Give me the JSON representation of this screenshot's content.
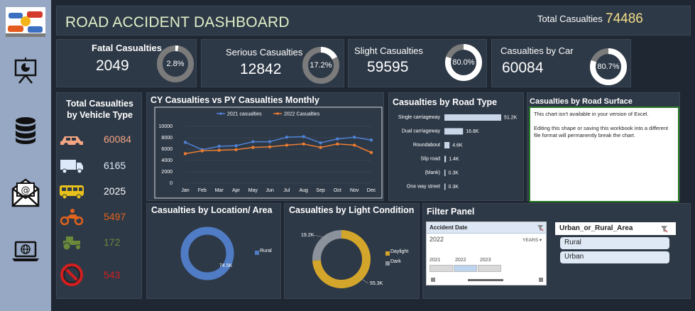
{
  "header": {
    "title": "ROAD ACCIDENT DASHBOARD",
    "total_label": "Total Casualties",
    "total_value": "74486"
  },
  "kpis": [
    {
      "label": "Fatal Casualties",
      "value": "2049",
      "pct": "2.8%",
      "fraction": 0.028
    },
    {
      "label": "Serious Casualties",
      "value": "12842",
      "pct": "17.2%",
      "fraction": 0.172
    },
    {
      "label": "Slight Casualties",
      "value": "59595",
      "pct": "80.0%",
      "fraction": 0.8
    },
    {
      "label": "Casualties by Car",
      "value": "60084",
      "pct": "80.7%",
      "fraction": 0.807
    }
  ],
  "vehicles": {
    "title_line1": "Total Casualties",
    "title_line2": "by Vehicle Type",
    "items": [
      {
        "icon": "car-icon",
        "value": "60084",
        "color": "#f4a583"
      },
      {
        "icon": "truck-icon",
        "value": "6165",
        "color": "#dbe9f8"
      },
      {
        "icon": "bus-icon",
        "value": "2025",
        "color": "#ffffff"
      },
      {
        "icon": "motorbike-icon",
        "value": "5497",
        "color": "#e2631b"
      },
      {
        "icon": "tractor-icon",
        "value": "172",
        "color": "#6a8a3a"
      },
      {
        "icon": "no-entry-icon",
        "value": "543",
        "color": "#d21e1e"
      }
    ]
  },
  "monthly": {
    "title": "CY Casualties vs PY Casualties Monthly",
    "chart_data": {
      "type": "line",
      "categories": [
        "Jan",
        "Feb",
        "Mar",
        "Apr",
        "May",
        "Jun",
        "Jul",
        "Aug",
        "Sep",
        "Oct",
        "Nov",
        "Dec"
      ],
      "series": [
        {
          "name": "2021 casualties",
          "color": "#4f81d4",
          "values": [
            7200,
            5900,
            6500,
            6600,
            7300,
            7300,
            8100,
            8200,
            7100,
            7800,
            8100,
            7600
          ]
        },
        {
          "name": "2022 Casualties",
          "color": "#ed7d31",
          "values": [
            5200,
            5700,
            5800,
            5900,
            6300,
            6400,
            6700,
            6900,
            6300,
            6900,
            6700,
            5400
          ]
        }
      ],
      "y_ticks": [
        "0",
        "2000",
        "4000",
        "6000",
        "8000",
        "10000"
      ],
      "ylim": [
        0,
        10000
      ]
    }
  },
  "road_type": {
    "title": "Casualties by Road Type",
    "chart_data": {
      "type": "bar",
      "categories": [
        "Single carriageway",
        "Dual carriageway",
        "Roundabout",
        "Slip road",
        "(blank)",
        "One way street"
      ],
      "values": [
        51200,
        16800,
        4600,
        1400,
        300,
        300
      ],
      "labels": [
        "51.2K",
        "16.8K",
        "4.6K",
        "1.4K",
        "0.3K",
        "0.3K"
      ]
    }
  },
  "road_surface": {
    "title": "Casualties by Road Surface",
    "note_line1": "This chart isn't available in your version of Excel.",
    "note_line2": "Editing this shape or saving this workbook into a different file format will permanently break the chart."
  },
  "location": {
    "title": "Casualties by Location/ Area",
    "chart_data": {
      "type": "pie",
      "categories": [
        "Rural"
      ],
      "values": [
        74500
      ],
      "labels": [
        "74.5K"
      ],
      "colors": [
        "#4f7cc4"
      ]
    }
  },
  "light": {
    "title": "Casualties by Light Condition",
    "chart_data": {
      "type": "pie",
      "categories": [
        "Daylight",
        "Dark"
      ],
      "values": [
        55300,
        19200
      ],
      "labels": [
        "55.3K",
        "19.2K"
      ],
      "colors": [
        "#d3a52a",
        "#8b929c"
      ]
    }
  },
  "filter": {
    "title": "Filter Panel",
    "date_slicer": {
      "header": "Accident Date",
      "year": "2022",
      "period": "YEARS",
      "years": [
        "2021",
        "2022",
        "2023"
      ]
    },
    "area_slicer": {
      "header": "Urban_or_Rural_Area",
      "options": [
        "Rural",
        "Urban"
      ]
    }
  }
}
